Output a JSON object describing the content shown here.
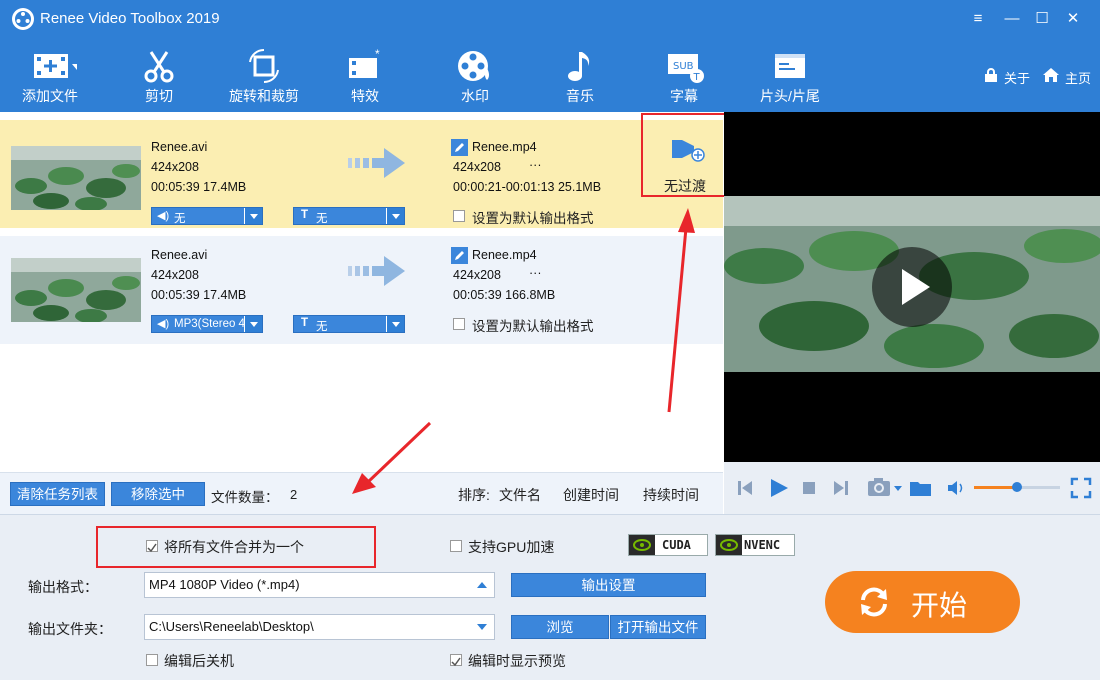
{
  "window": {
    "title": "Renee Video Toolbox 2019",
    "minimize": "—",
    "maximize": "☐",
    "close": "✕",
    "extra": "≡"
  },
  "toolbar": {
    "items": [
      {
        "label": "添加文件"
      },
      {
        "label": "剪切"
      },
      {
        "label": "旋转和裁剪"
      },
      {
        "label": "特效"
      },
      {
        "label": "水印"
      },
      {
        "label": "音乐"
      },
      {
        "label": "字幕"
      },
      {
        "label": "片头/片尾"
      }
    ],
    "about": "关于",
    "home": "主页"
  },
  "files": [
    {
      "src_name": "Renee.avi",
      "src_res": "424x208",
      "src_info": "00:05:39  17.4MB",
      "out_name": "Renee.mp4",
      "out_res": "424x208",
      "out_more": "···",
      "out_info": "00:00:21-00:01:13  25.1MB",
      "audio": "无",
      "subtitle": "无",
      "default_label": "设置为默认输出格式",
      "transition": "无过渡"
    },
    {
      "src_name": "Renee.avi",
      "src_res": "424x208",
      "src_info": "00:05:39  17.4MB",
      "out_name": "Renee.mp4",
      "out_res": "424x208",
      "out_more": "···",
      "out_info": "00:05:39  166.8MB",
      "audio": "MP3(Stereo 4",
      "subtitle": "无",
      "default_label": "设置为默认输出格式"
    }
  ],
  "listbar": {
    "clear": "清除任务列表",
    "remove": "移除选中",
    "count_label": "文件数量：",
    "count": "2",
    "sort_label": "排序:",
    "sort_name": "文件名",
    "sort_created": "创建时间",
    "sort_duration": "持续时间"
  },
  "bottom": {
    "merge_label": "将所有文件合并为一个",
    "merge_checked": true,
    "gpu_label": "支持GPU加速",
    "gpu_checked": false,
    "cuda": "CUDA",
    "nvenc": "NVENC",
    "format_label": "输出格式：",
    "format_value": "MP4 1080P Video (*.mp4)",
    "settings_btn": "输出设置",
    "folder_label": "输出文件夹：",
    "folder_value": "C:\\Users\\Reneelab\\Desktop\\",
    "browse_btn": "浏览",
    "open_btn": "打开输出文件",
    "shutdown_label": "编辑后关机",
    "shutdown_checked": false,
    "preview_label": "编辑时显示预览",
    "preview_checked": true,
    "start_btn": "开始"
  },
  "colors": {
    "accent": "#2f7fd5",
    "highlight_row": "#fbeeb2",
    "start": "#f5821f",
    "annotation": "#e8262b"
  }
}
